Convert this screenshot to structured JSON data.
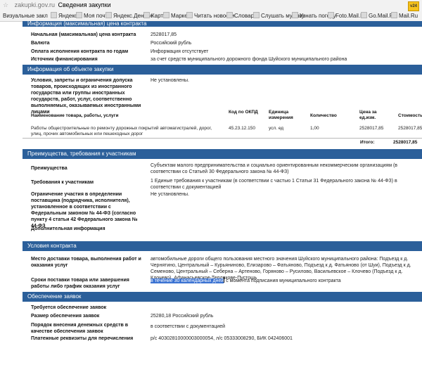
{
  "browser": {
    "url_host": "zakupki.gov.ru",
    "page_title": "Сведения закупки",
    "bookmarks": [
      "Визуальные закл",
      "Яндекс",
      "Моя почта",
      "Яндекс.Деньги",
      "Карты",
      "Маркет",
      "Читать новости",
      "Словари",
      "Слушать музыку",
      "Узнать погоду",
      "Foto.Mail.Ru",
      "Go.Mail.Ru",
      "Mail.Ru"
    ],
    "extension_badge": "v24"
  },
  "contract_info": {
    "header": "Информация (максимальная) цена контракта",
    "rows": [
      {
        "label": "Начальная (максимальная) цена контракта",
        "value": "2528017,85"
      },
      {
        "label": "Валюта",
        "value": "Российский рубль"
      },
      {
        "label": "Оплата исполнения контракта по годам",
        "value": "Информация отсутствует"
      },
      {
        "label": "Источник финансирования",
        "value": "за счет средств муниципального дорожного фонда Шуйского муниципального района"
      }
    ]
  },
  "object": {
    "header": "Информация об объекте закупки",
    "restrictions_label": "Условия, запреты и ограничения допуска товаров, происходящих из иностранного государства или группы иностранных государств, работ, услуг, соответственно выполняемых, оказываемых иностранными лицами",
    "restrictions_value": "Не установлены.",
    "columns": {
      "name": "Наименование товара, работы, услуги",
      "okpd": "Код по ОКПД",
      "unit": "Единица измерения",
      "qty": "Количество",
      "price": "Цена за ед.изм.",
      "cost": "Стоимость"
    },
    "item": {
      "name": "Работы общестроительные по ремонту дорожных покрытий автомагистралей, дорог, улиц, прочих автомобильных или пешеходных дорог",
      "okpd": "45.23.12.150",
      "unit": "усл. ед",
      "qty": "1,00",
      "price": "2528017,85",
      "cost": "2528017,85"
    },
    "total_label": "Итого:",
    "total_value": "2528017,85"
  },
  "advantages": {
    "header": "Преимущества, требования к участникам",
    "rows": [
      {
        "label": "Преимущества",
        "value": "Субъектам малого предпринимательства и социально ориентированным некоммерческим организациям (в соответствии со Статьей 30 Федерального закона № 44-ФЗ)"
      },
      {
        "label": "Требования к участникам",
        "value": "1 Единые требования к участникам (в соответствии с частью 1 Статьи 31 Федерального закона № 44-ФЗ) в соответствии с документацией"
      },
      {
        "label": "Ограничение участия в определении поставщика (подрядчика, исполнителя), установленное в соответствии с Федеральным законом № 44-ФЗ (согласно пункту 4 статьи 42 Федерального закона № 44-ФЗ",
        "value": "Не установлены."
      },
      {
        "label": "Дополнительная информация",
        "value": ""
      }
    ]
  },
  "terms": {
    "header": "Условия контракта",
    "place_label": "Место доставки товара, выполнения работ и оказания услуг",
    "place_value": "автомобильные дороги общего пользования местного значения Шуйского муниципального района: Подъезд к д. Чернятино, Центральный – Курьяниново, Елизарово – Фатьяново, Подъезд к д. Фатьяново (от Шуи), Подъезд к д. Семеново, Центральный – Себерна – Артеново, Горяново – Русилово, Васильевское – Клочево (Подъезд к д. Клочево), Афанасьевское-Теплякове-Пустошь",
    "deadline_label": "Сроки поставки товара или завершения работы либо график оказания услуг",
    "deadline_highlight": "в течение 30 календарных дней",
    "deadline_rest": "с момента подписания муниципального контракта"
  },
  "security": {
    "header": "Обеспечение заявок",
    "rows": [
      {
        "label": "Требуется обеспечение заявок",
        "value": ""
      },
      {
        "label": "Размер обеспечения заявок",
        "value": "25280,18 Российский рубль"
      },
      {
        "label": "Порядок внесения денежных средств в качестве обеспечения заявок",
        "value": "в соответствии с документацией"
      },
      {
        "label": "Платежные реквизиты для перечисления",
        "value": "р/с 40302810000003000054,  л/с 05333008290,  БИК 042406001"
      }
    ]
  }
}
